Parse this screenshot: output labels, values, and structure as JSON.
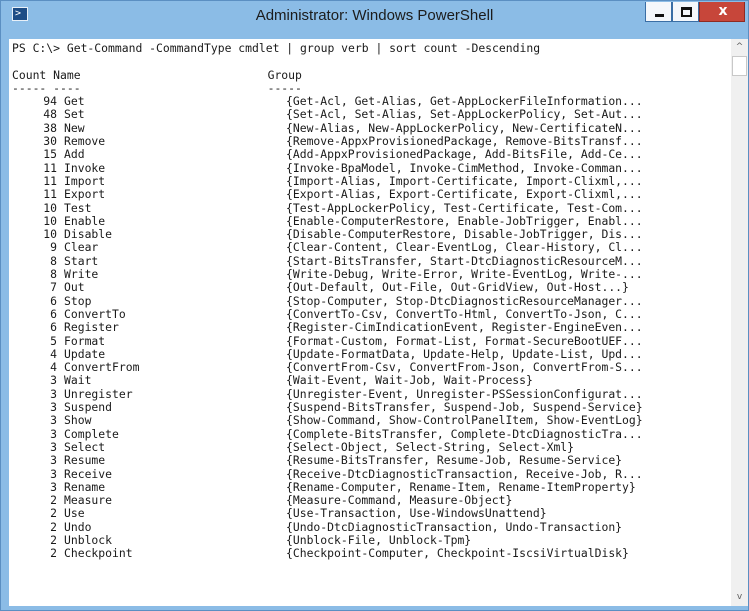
{
  "window": {
    "title": "Administrator: Windows PowerShell",
    "icon": "powershell-icon",
    "minimize_icon": "minimize-icon",
    "maximize_icon": "maximize-icon",
    "close_icon": "close-icon",
    "close_glyph": "x"
  },
  "console": {
    "prompt_line": "PS C:\\> Get-Command -CommandType cmdlet | group verb | sort count -Descending",
    "headers": {
      "count": "Count",
      "name": "Name",
      "group": "Group"
    },
    "separators": {
      "count": "-----",
      "name": "----",
      "group": "-----"
    },
    "rows": [
      {
        "count": "94",
        "name": "Get",
        "group": "{Get-Acl, Get-Alias, Get-AppLockerFileInformation..."
      },
      {
        "count": "48",
        "name": "Set",
        "group": "{Set-Acl, Set-Alias, Set-AppLockerPolicy, Set-Aut..."
      },
      {
        "count": "38",
        "name": "New",
        "group": "{New-Alias, New-AppLockerPolicy, New-CertificateN..."
      },
      {
        "count": "30",
        "name": "Remove",
        "group": "{Remove-AppxProvisionedPackage, Remove-BitsTransf..."
      },
      {
        "count": "15",
        "name": "Add",
        "group": "{Add-AppxProvisionedPackage, Add-BitsFile, Add-Ce..."
      },
      {
        "count": "11",
        "name": "Invoke",
        "group": "{Invoke-BpaModel, Invoke-CimMethod, Invoke-Comman..."
      },
      {
        "count": "11",
        "name": "Import",
        "group": "{Import-Alias, Import-Certificate, Import-Clixml,..."
      },
      {
        "count": "11",
        "name": "Export",
        "group": "{Export-Alias, Export-Certificate, Export-Clixml,..."
      },
      {
        "count": "10",
        "name": "Test",
        "group": "{Test-AppLockerPolicy, Test-Certificate, Test-Com..."
      },
      {
        "count": "10",
        "name": "Enable",
        "group": "{Enable-ComputerRestore, Enable-JobTrigger, Enabl..."
      },
      {
        "count": "10",
        "name": "Disable",
        "group": "{Disable-ComputerRestore, Disable-JobTrigger, Dis..."
      },
      {
        "count": "9",
        "name": "Clear",
        "group": "{Clear-Content, Clear-EventLog, Clear-History, Cl..."
      },
      {
        "count": "8",
        "name": "Start",
        "group": "{Start-BitsTransfer, Start-DtcDiagnosticResourceM..."
      },
      {
        "count": "8",
        "name": "Write",
        "group": "{Write-Debug, Write-Error, Write-EventLog, Write-..."
      },
      {
        "count": "7",
        "name": "Out",
        "group": "{Out-Default, Out-File, Out-GridView, Out-Host...}"
      },
      {
        "count": "6",
        "name": "Stop",
        "group": "{Stop-Computer, Stop-DtcDiagnosticResourceManager..."
      },
      {
        "count": "6",
        "name": "ConvertTo",
        "group": "{ConvertTo-Csv, ConvertTo-Html, ConvertTo-Json, C..."
      },
      {
        "count": "6",
        "name": "Register",
        "group": "{Register-CimIndicationEvent, Register-EngineEven..."
      },
      {
        "count": "5",
        "name": "Format",
        "group": "{Format-Custom, Format-List, Format-SecureBootUEF..."
      },
      {
        "count": "4",
        "name": "Update",
        "group": "{Update-FormatData, Update-Help, Update-List, Upd..."
      },
      {
        "count": "4",
        "name": "ConvertFrom",
        "group": "{ConvertFrom-Csv, ConvertFrom-Json, ConvertFrom-S..."
      },
      {
        "count": "3",
        "name": "Wait",
        "group": "{Wait-Event, Wait-Job, Wait-Process}"
      },
      {
        "count": "3",
        "name": "Unregister",
        "group": "{Unregister-Event, Unregister-PSSessionConfigurat..."
      },
      {
        "count": "3",
        "name": "Suspend",
        "group": "{Suspend-BitsTransfer, Suspend-Job, Suspend-Service}"
      },
      {
        "count": "3",
        "name": "Show",
        "group": "{Show-Command, Show-ControlPanelItem, Show-EventLog}"
      },
      {
        "count": "3",
        "name": "Complete",
        "group": "{Complete-BitsTransfer, Complete-DtcDiagnosticTra..."
      },
      {
        "count": "3",
        "name": "Select",
        "group": "{Select-Object, Select-String, Select-Xml}"
      },
      {
        "count": "3",
        "name": "Resume",
        "group": "{Resume-BitsTransfer, Resume-Job, Resume-Service}"
      },
      {
        "count": "3",
        "name": "Receive",
        "group": "{Receive-DtcDiagnosticTransaction, Receive-Job, R..."
      },
      {
        "count": "3",
        "name": "Rename",
        "group": "{Rename-Computer, Rename-Item, Rename-ItemProperty}"
      },
      {
        "count": "2",
        "name": "Measure",
        "group": "{Measure-Command, Measure-Object}"
      },
      {
        "count": "2",
        "name": "Use",
        "group": "{Use-Transaction, Use-WindowsUnattend}"
      },
      {
        "count": "2",
        "name": "Undo",
        "group": "{Undo-DtcDiagnosticTransaction, Undo-Transaction}"
      },
      {
        "count": "2",
        "name": "Unblock",
        "group": "{Unblock-File, Unblock-Tpm}"
      },
      {
        "count": "2",
        "name": "Checkpoint",
        "group": "{Checkpoint-Computer, Checkpoint-IscsiVirtualDisk}"
      }
    ]
  },
  "scrollbar": {
    "up_icon": "scroll-up-arrow-icon",
    "down_icon": "scroll-down-arrow-icon",
    "up_glyph": "^",
    "down_glyph": "v"
  },
  "colors": {
    "frame": "#8bbce6",
    "console_background": "#ffffff",
    "console_text": "#1a1a1a",
    "close_button": "#c7463a"
  }
}
